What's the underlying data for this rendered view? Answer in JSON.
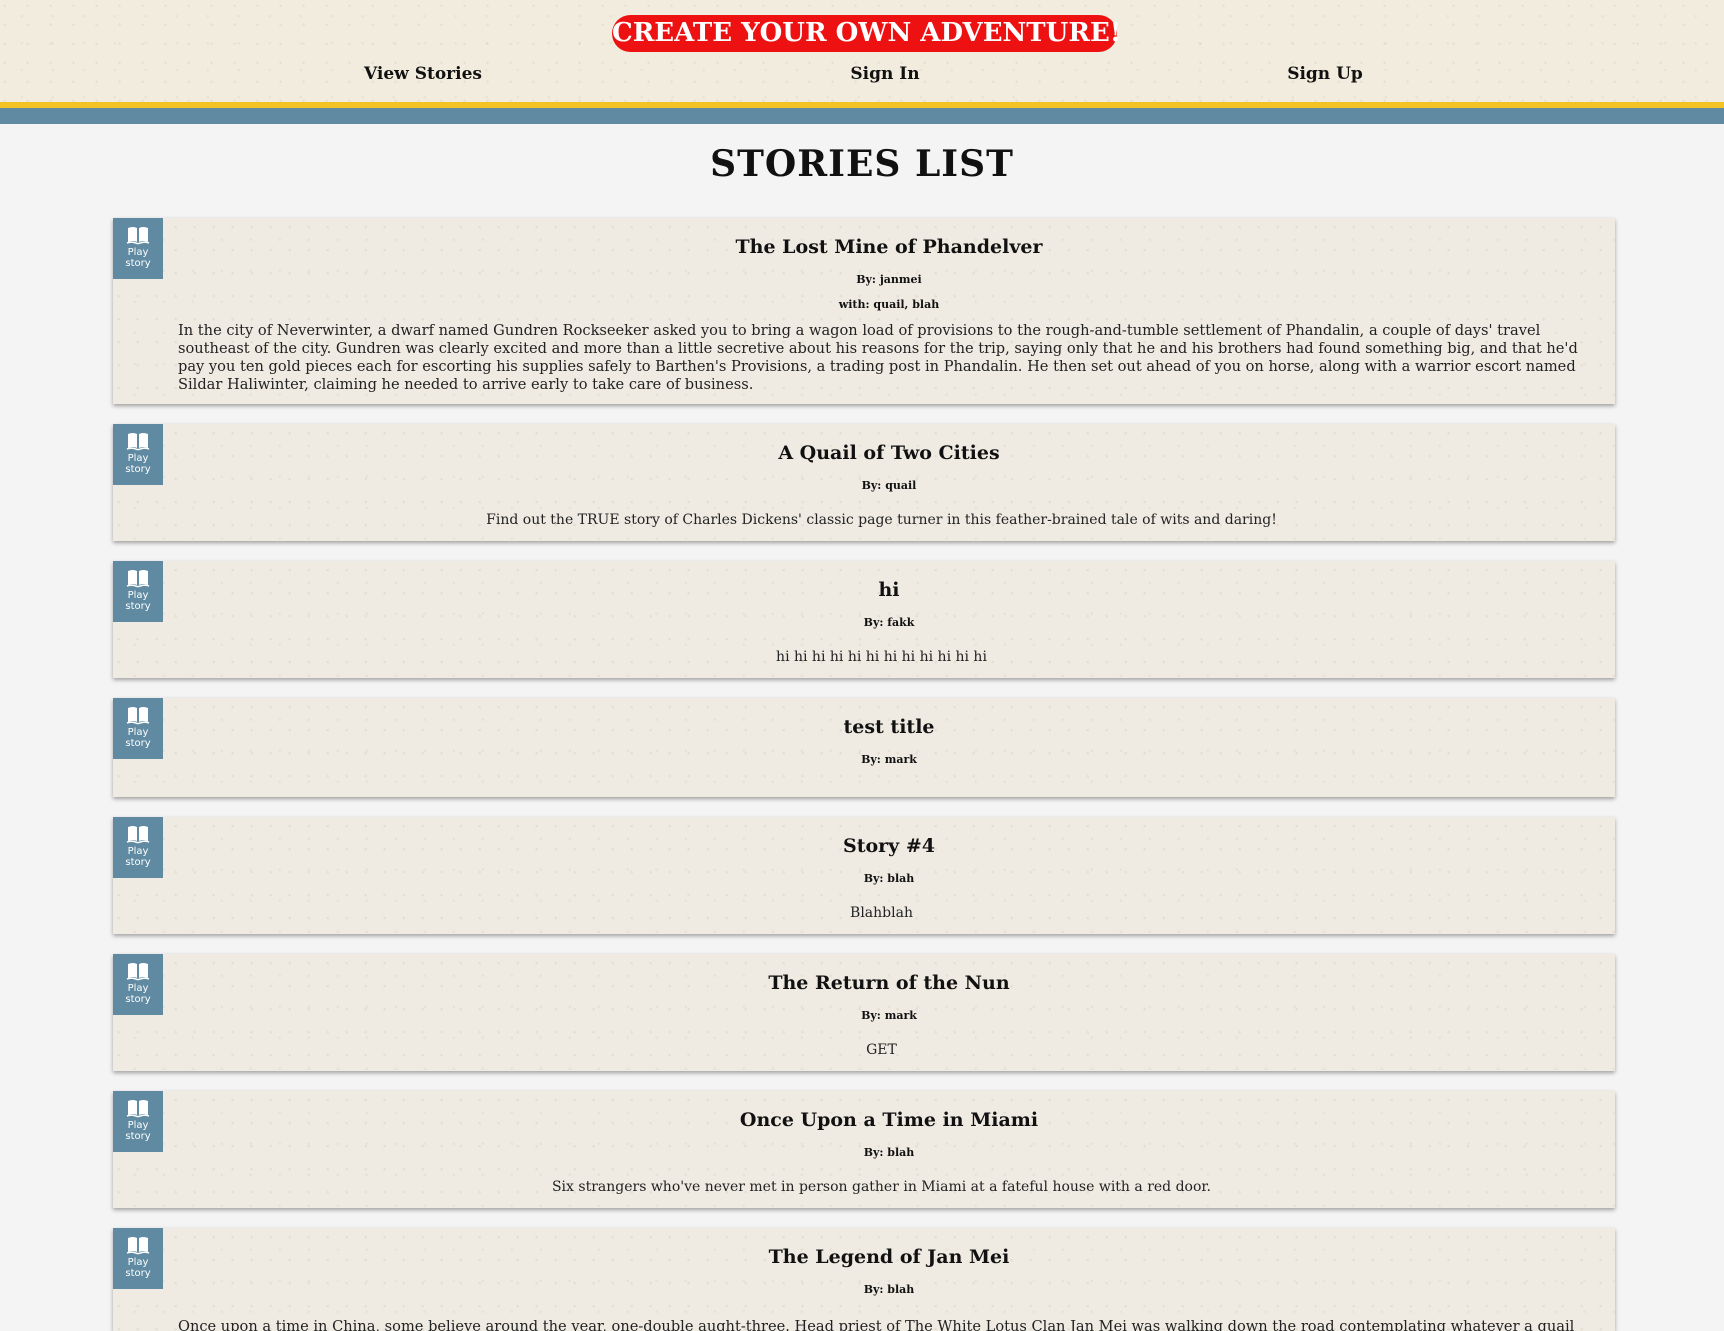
{
  "header": {
    "logo_text": "CREATE YOUR OWN ADVENTURE!",
    "nav": [
      {
        "label": "View Stories"
      },
      {
        "label": "Sign In"
      },
      {
        "label": "Sign Up"
      }
    ]
  },
  "page_title": "STORIES LIST",
  "play_label": "Play story",
  "stories": [
    {
      "title": "The Lost Mine of Phandelver",
      "by": "By: janmei",
      "with": "with: quail, blah",
      "description": "In the city of Neverwinter, a dwarf named Gundren Rockseeker asked you to bring a wagon load of provisions to the rough-and-tumble settlement of Phandalin, a couple of days' travel southeast of the city. Gundren was clearly excited and more than a little secretive about his reasons for the trip, saying only that he and his brothers had found something big, and that he'd pay you ten gold pieces each for escorting his supplies safely to Barthen's Provisions, a trading post in Phandalin. He then set out ahead of you on horse, along with a warrior escort named Sildar Haliwinter, claiming he needed to arrive early to take care of business."
    },
    {
      "title": "A Quail of Two Cities",
      "by": "By: quail",
      "description": "Find out the TRUE story of Charles Dickens' classic page turner in this feather-brained tale of wits and daring!"
    },
    {
      "title": "hi",
      "by": "By: fakk",
      "description": "hi hi hi hi hi hi hi hi hi hi hi hi"
    },
    {
      "title": "test title",
      "by": "By: mark",
      "description": ""
    },
    {
      "title": "Story #4",
      "by": "By: blah",
      "description": "Blahblah"
    },
    {
      "title": "The Return of the Nun",
      "by": "By: mark",
      "description": "GET"
    },
    {
      "title": "Once Upon a Time in Miami",
      "by": "By: blah",
      "description": "Six strangers who've never met in person gather in Miami at a fateful house with a red door."
    },
    {
      "title": "The Legend of Jan Mei",
      "by": "By: blah",
      "description": "Once upon a time in China, some believe around the year, one-double aught-three. Head priest of The White Lotus Clan Jan Mei was walking down the road contemplating whatever a quail with Jan"
    }
  ],
  "colors": {
    "logo_bg": "#ee1111",
    "header_bg": "#f1ecdd",
    "stripe_yellow": "#f3c224",
    "stripe_blue": "#5f8aa1",
    "card_bg": "#efebe2",
    "page_bg": "#f4f4f4"
  },
  "icons": {
    "play_button": "open-book-icon"
  }
}
